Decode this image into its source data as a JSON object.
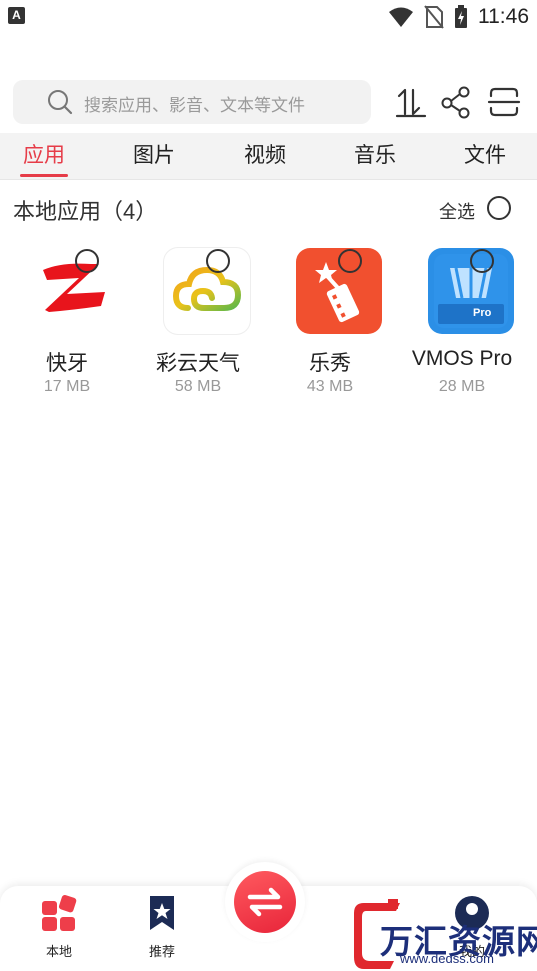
{
  "status_bar": {
    "time": "11:46",
    "icons": [
      "a-notification-icon",
      "wifi-icon",
      "no-sim-icon",
      "battery-charging-icon"
    ]
  },
  "search": {
    "placeholder": "搜索应用、影音、文本等文件"
  },
  "header_icons": [
    "sort-icon",
    "share-icon",
    "scan-icon"
  ],
  "tabs": [
    {
      "label": "应用",
      "active": true
    },
    {
      "label": "图片",
      "active": false
    },
    {
      "label": "视频",
      "active": false
    },
    {
      "label": "音乐",
      "active": false
    },
    {
      "label": "文件",
      "active": false
    }
  ],
  "section": {
    "title": "本地应用（4）",
    "select_all": "全选"
  },
  "apps": [
    {
      "name": "快牙",
      "size": "17 MB",
      "icon": "kuaiya-logo-icon"
    },
    {
      "name": "彩云天气",
      "size": "58 MB",
      "icon": "caiyun-weather-icon"
    },
    {
      "name": "乐秀",
      "size": "43 MB",
      "icon": "lexiu-icon"
    },
    {
      "name": "VMOS Pro",
      "size": "28 MB",
      "icon": "vmos-pro-icon",
      "icon_text": "Pro"
    }
  ],
  "bottom_nav": {
    "local": "本地",
    "recommend": "推荐",
    "mine": "我的"
  },
  "watermark": {
    "text": "万汇资源网",
    "url": "www.dedss.com"
  },
  "colors": {
    "accent": "#e63c48",
    "tab_bg": "#f3f3f3",
    "search_bg": "#f2f2f2"
  }
}
